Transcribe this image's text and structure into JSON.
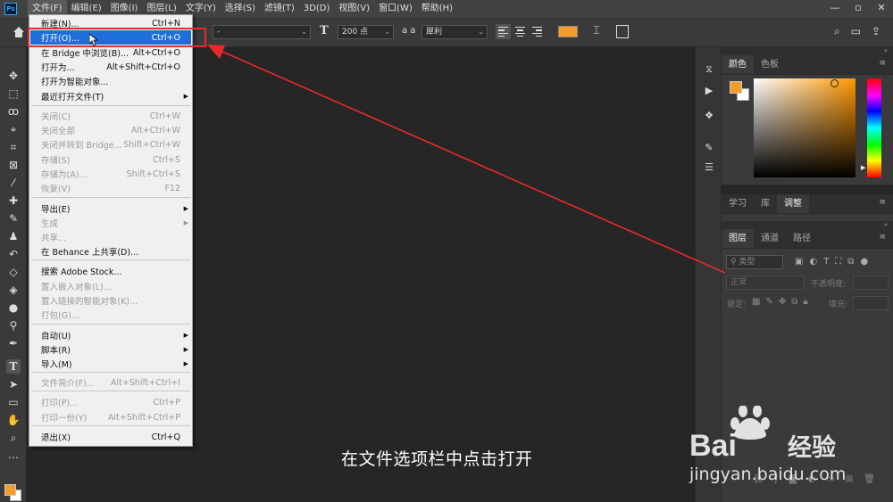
{
  "app": {
    "logo_text": "Ps"
  },
  "menubar": {
    "items": [
      "文件(F)",
      "编辑(E)",
      "图像(I)",
      "图层(L)",
      "文字(Y)",
      "选择(S)",
      "滤镜(T)",
      "3D(D)",
      "视图(V)",
      "窗口(W)",
      "帮助(H)"
    ],
    "active_index": 0
  },
  "window_controls": {
    "minimize": "—",
    "maximize": "▫",
    "close": "✕"
  },
  "options_bar": {
    "font_style": "-",
    "font_size": "200 点",
    "aa_label": "a a",
    "antialias": "犀利",
    "text_color": "#f39c28"
  },
  "file_menu": {
    "items": [
      {
        "label": "新建(N)...",
        "shortcut": "Ctrl+N",
        "enabled": true
      },
      {
        "label": "打开(O)...",
        "shortcut": "Ctrl+O",
        "enabled": true,
        "highlighted": true
      },
      {
        "label": "在 Bridge 中浏览(B)...",
        "shortcut": "Alt+Ctrl+O",
        "enabled": true
      },
      {
        "label": "打开为...",
        "shortcut": "Alt+Shift+Ctrl+O",
        "enabled": true
      },
      {
        "label": "打开为智能对象...",
        "shortcut": "",
        "enabled": true
      },
      {
        "label": "最近打开文件(T)",
        "shortcut": "",
        "enabled": true,
        "submenu": true
      },
      {
        "label": "关闭(C)",
        "shortcut": "Ctrl+W",
        "enabled": false
      },
      {
        "label": "关闭全部",
        "shortcut": "Alt+Ctrl+W",
        "enabled": false
      },
      {
        "label": "关闭并转到 Bridge...",
        "shortcut": "Shift+Ctrl+W",
        "enabled": false
      },
      {
        "label": "存储(S)",
        "shortcut": "Ctrl+S",
        "enabled": false
      },
      {
        "label": "存储为(A)...",
        "shortcut": "Shift+Ctrl+S",
        "enabled": false
      },
      {
        "label": "恢复(V)",
        "shortcut": "F12",
        "enabled": false
      },
      {
        "label": "导出(E)",
        "shortcut": "",
        "enabled": true,
        "submenu": true
      },
      {
        "label": "生成",
        "shortcut": "",
        "enabled": false,
        "submenu": true
      },
      {
        "label": "共享...",
        "shortcut": "",
        "enabled": false
      },
      {
        "label": "在 Behance 上共享(D)...",
        "shortcut": "",
        "enabled": true
      },
      {
        "label": "搜索 Adobe Stock...",
        "shortcut": "",
        "enabled": true
      },
      {
        "label": "置入嵌入对象(L)...",
        "shortcut": "",
        "enabled": false
      },
      {
        "label": "置入链接的智能对象(K)...",
        "shortcut": "",
        "enabled": false
      },
      {
        "label": "打包(G)...",
        "shortcut": "",
        "enabled": false
      },
      {
        "label": "自动(U)",
        "shortcut": "",
        "enabled": true,
        "submenu": true
      },
      {
        "label": "脚本(R)",
        "shortcut": "",
        "enabled": true,
        "submenu": true
      },
      {
        "label": "导入(M)",
        "shortcut": "",
        "enabled": true,
        "submenu": true
      },
      {
        "label": "文件简介(F)...",
        "shortcut": "Alt+Shift+Ctrl+I",
        "enabled": false
      },
      {
        "label": "打印(P)...",
        "shortcut": "Ctrl+P",
        "enabled": false
      },
      {
        "label": "打印一份(Y)",
        "shortcut": "Alt+Shift+Ctrl+P",
        "enabled": false
      },
      {
        "label": "退出(X)",
        "shortcut": "Ctrl+Q",
        "enabled": true
      }
    ]
  },
  "color_panel": {
    "tabs": [
      "颜色",
      "色板"
    ],
    "active_tab": 0,
    "foreground": "#f39c28",
    "background": "#ffffff"
  },
  "adjust_panel": {
    "tabs": [
      "学习",
      "库",
      "调整"
    ],
    "active_tab": 2
  },
  "layers_panel": {
    "tabs": [
      "图层",
      "通道",
      "路径"
    ],
    "active_tab": 0,
    "filter_label": "类型",
    "blend_mode": "正常",
    "opacity_label": "不透明度:",
    "lock_label": "锁定:",
    "fill_label": "填充:"
  },
  "subtitle": "在文件选项栏中点击打开",
  "watermark": {
    "brand": "Bai",
    "brand2": "经验",
    "url": "jingyan.baidu.com"
  }
}
